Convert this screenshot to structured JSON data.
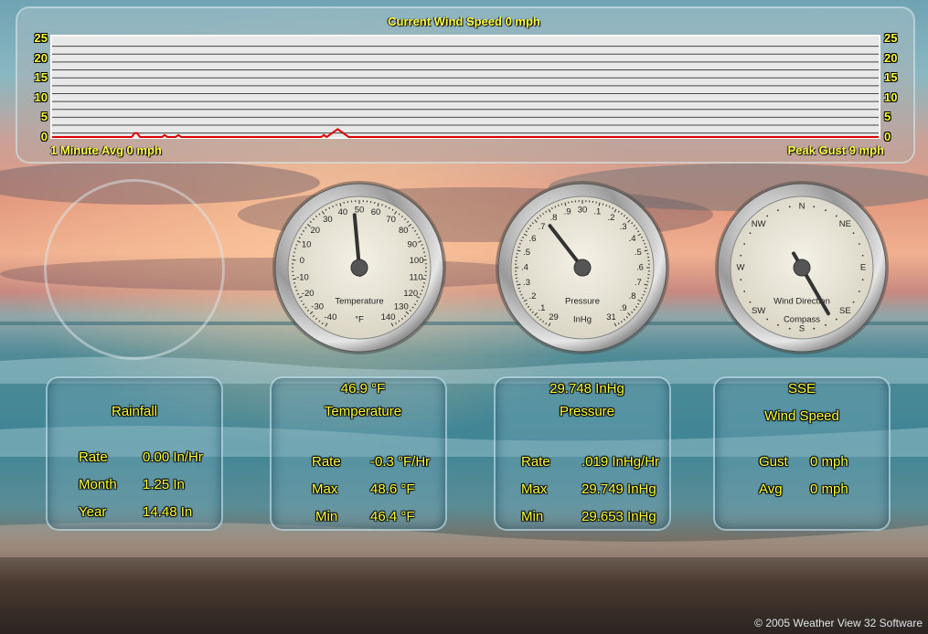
{
  "chart": {
    "title": "Current Wind Speed 0 mph",
    "avg_label": "1 Minute Avg 0 mph",
    "gust_label": "Peak Gust 9 mph",
    "y_ticks": [
      "25",
      "20",
      "15",
      "10",
      "5",
      "0"
    ]
  },
  "chart_data": {
    "type": "line",
    "title": "Current Wind Speed 0 mph",
    "ylim": [
      0,
      25
    ],
    "y_ticks": [
      0,
      5,
      10,
      15,
      20,
      25
    ],
    "grid": true,
    "series": [
      {
        "values": [
          0,
          0,
          0,
          0,
          0,
          0,
          0,
          0,
          0,
          0,
          0,
          0,
          0,
          0,
          0,
          0,
          0,
          0,
          0,
          0,
          0,
          0,
          0,
          0,
          0,
          0,
          0,
          0,
          0,
          0,
          1,
          1,
          0,
          0,
          0,
          0,
          0,
          0,
          0,
          0,
          0,
          0.5,
          0,
          0,
          0,
          0,
          0.5,
          0,
          0,
          0,
          0,
          0,
          0,
          0,
          0,
          0,
          0,
          0,
          0,
          0,
          0,
          0,
          0,
          0,
          0,
          0,
          0,
          0,
          0,
          0,
          0,
          0,
          0,
          0,
          0,
          0,
          0,
          0,
          0,
          0,
          0,
          0,
          0,
          0,
          0,
          0,
          0,
          0,
          0,
          0,
          0,
          0,
          0,
          0,
          0,
          0,
          0,
          0,
          0,
          0.5,
          0,
          0.5,
          1,
          1.5,
          2,
          1.5,
          1,
          0.5,
          0,
          0,
          0,
          0,
          0,
          0,
          0,
          0,
          0,
          0,
          0,
          0,
          0,
          0,
          0,
          0,
          0,
          0,
          0,
          0,
          0,
          0,
          0,
          0,
          0,
          0,
          0,
          0,
          0,
          0,
          0,
          0,
          0,
          0,
          0,
          0,
          0,
          0,
          0,
          0,
          0,
          0,
          0,
          0,
          0,
          0,
          0,
          0,
          0,
          0,
          0,
          0,
          0,
          0,
          0,
          0,
          0,
          0,
          0,
          0,
          0,
          0,
          0,
          0,
          0,
          0,
          0,
          0,
          0,
          0,
          0,
          0,
          0,
          0,
          0,
          0,
          0,
          0,
          0,
          0,
          0,
          0,
          0,
          0,
          0,
          0,
          0,
          0,
          0,
          0,
          0,
          0,
          0,
          0,
          0,
          0,
          0,
          0,
          0,
          0,
          0,
          0,
          0,
          0,
          0,
          0,
          0,
          0,
          0,
          0,
          0,
          0,
          0,
          0,
          0,
          0,
          0,
          0,
          0,
          0,
          0,
          0,
          0,
          0,
          0,
          0,
          0,
          0,
          0,
          0,
          0,
          0,
          0,
          0,
          0,
          0,
          0,
          0,
          0,
          0,
          0,
          0,
          0,
          0,
          0,
          0,
          0,
          0,
          0,
          0,
          0,
          0,
          0,
          0,
          0,
          0,
          0,
          0,
          0,
          0,
          0,
          0,
          0,
          0,
          0,
          0,
          0,
          0,
          0,
          0,
          0,
          0,
          0,
          0,
          0,
          0,
          0,
          0,
          0,
          0,
          0,
          0,
          0,
          0,
          0,
          0,
          0,
          0,
          0,
          0,
          0,
          0,
          0,
          0
        ],
        "color": "#dd0000"
      }
    ]
  },
  "gauges": {
    "temperature": {
      "label": "Temperature",
      "unit": "°F",
      "ticks": [
        "-40",
        "-30",
        "-20",
        "-10",
        "0",
        "10",
        "20",
        "30",
        "40",
        "50",
        "60",
        "70",
        "80",
        "90",
        "100",
        "110",
        "120",
        "130",
        "140"
      ],
      "min": -40,
      "max": 140,
      "value": 46.9
    },
    "pressure": {
      "label": "Pressure",
      "unit": "InHg",
      "ticks": [
        "29",
        ".1",
        ".2",
        ".3",
        ".4",
        ".5",
        ".6",
        ".7",
        ".8",
        ".9",
        "30",
        ".1",
        ".2",
        ".3",
        ".4",
        ".5",
        ".6",
        ".7",
        ".8",
        ".9",
        "31"
      ],
      "min": 29,
      "max": 31,
      "value": 29.748
    },
    "wind": {
      "label": "Wind Direction",
      "sublabel": "Compass",
      "ticks": [
        "N",
        "NE",
        "E",
        "SE",
        "S",
        "SW",
        "W",
        "NW"
      ],
      "direction_deg": 150
    }
  },
  "rainfall": {
    "title": "Rainfall",
    "rows": [
      {
        "label": "Rate",
        "value": "0.00 In/Hr"
      },
      {
        "label": "Month",
        "value": "1.25 In"
      },
      {
        "label": "Year",
        "value": "14.48 In"
      }
    ]
  },
  "temperature": {
    "current": "46.9 °F",
    "title": "Temperature",
    "rows": [
      {
        "label": "Rate",
        "value": "-0.3 °F/Hr"
      },
      {
        "label": "Max",
        "value": "48.6 °F"
      },
      {
        "label": "Min",
        "value": "46.4 °F"
      }
    ]
  },
  "pressure": {
    "current": "29.748 InHg",
    "title": "Pressure",
    "rows": [
      {
        "label": "Rate",
        "value": ".019 InHg/Hr"
      },
      {
        "label": "Max",
        "value": "29.749 InHg"
      },
      {
        "label": "Min",
        "value": "29.653 InHg"
      }
    ]
  },
  "wind": {
    "current": "SSE",
    "title": "Wind Speed",
    "rows": [
      {
        "label": "Gust",
        "value": "0 mph"
      },
      {
        "label": "Avg",
        "value": "0 mph"
      }
    ]
  },
  "footer": {
    "copyright": "© 2005 Weather View 32 Software"
  }
}
